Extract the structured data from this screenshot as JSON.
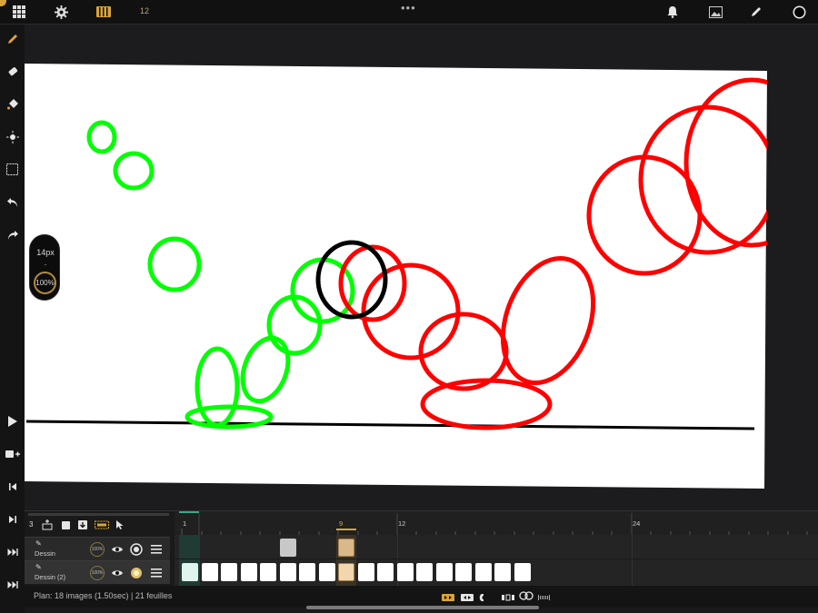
{
  "topbar": {
    "frame_count": "12",
    "more_dots": "•••"
  },
  "brush": {
    "size": "14px",
    "dash": "-",
    "opacity": "100%"
  },
  "timeline": {
    "layer_count": "3",
    "ruler": {
      "label_1": "1",
      "label_9": "9",
      "label_12": "12",
      "label_24": "24"
    },
    "layers": [
      {
        "name": "Dessin",
        "opacity": "100%"
      },
      {
        "name": "Dessin (2)",
        "opacity": "100%"
      }
    ],
    "status": "Plan: 18 images (1.50sec) | 21 feuilles"
  },
  "colors": {
    "accent": "#d9a53a",
    "ball_green": "#00ff00",
    "ball_red": "#ff0000",
    "ball_black": "#000000",
    "canvas": "#ffffff"
  },
  "icons": {
    "top": [
      "grid-icon",
      "gear-icon",
      "film-icon",
      "bell-icon",
      "image-icon",
      "pen-icon",
      "color-circle-icon"
    ],
    "left": [
      "pencil-icon",
      "eraser-icon",
      "fill-bucket-icon",
      "lasso-icon",
      "selection-icon",
      "undo-icon",
      "redo-icon",
      "play-icon",
      "add-frame-icon",
      "prev-frame-icon",
      "next-frame-icon",
      "last-frame-icon"
    ]
  }
}
